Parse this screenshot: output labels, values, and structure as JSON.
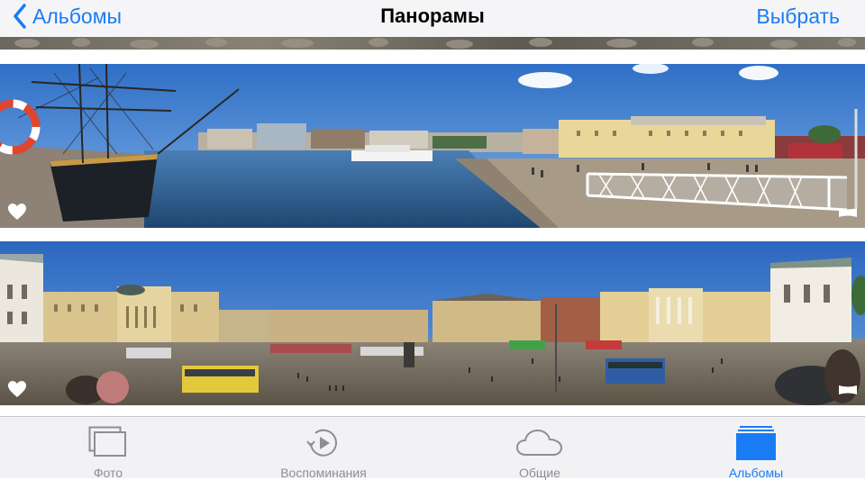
{
  "nav": {
    "back_label": "Альбомы",
    "title": "Панорамы",
    "action_label": "Выбрать"
  },
  "photos": [
    {
      "favorite": true,
      "type": "panorama"
    },
    {
      "favorite": true,
      "type": "panorama"
    }
  ],
  "tabs": [
    {
      "label": "Фото",
      "icon": "photos-icon",
      "active": false
    },
    {
      "label": "Воспоминания",
      "icon": "memories-icon",
      "active": false
    },
    {
      "label": "Общие",
      "icon": "cloud-icon",
      "active": false
    },
    {
      "label": "Альбомы",
      "icon": "albums-icon",
      "active": true
    }
  ],
  "colors": {
    "accent": "#1a7cf4",
    "tab_inactive": "#8e8e93",
    "sky": "#3a79c9",
    "water": "#2d5f94"
  }
}
